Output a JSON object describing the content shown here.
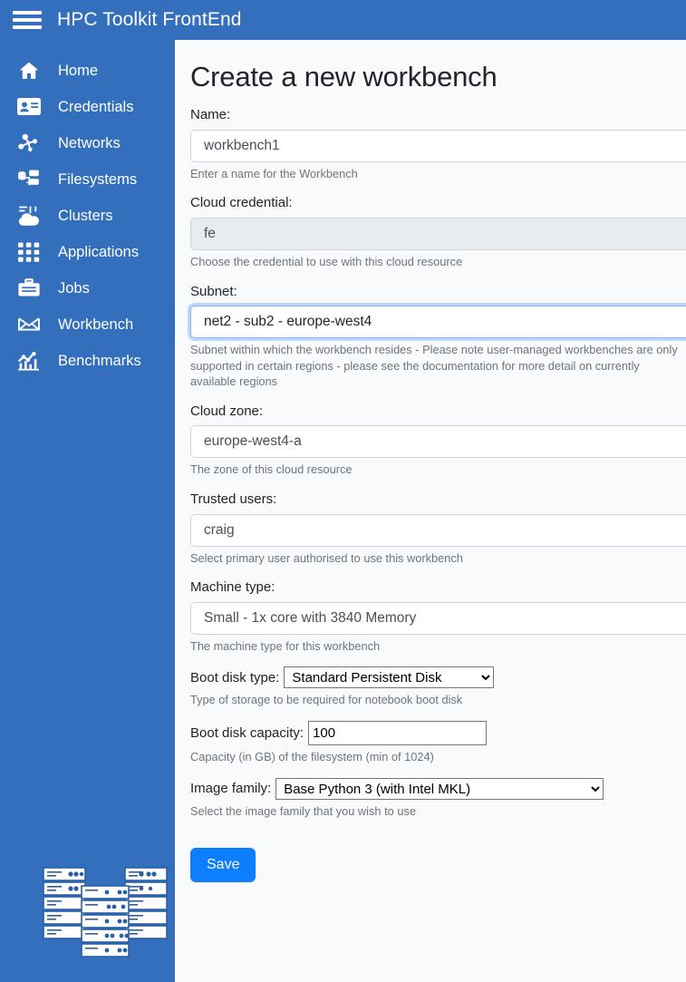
{
  "header": {
    "brand": "HPC Toolkit FrontEnd",
    "menu_icon": "hamburger-icon"
  },
  "theme": {
    "brand_blue": "#336fbc",
    "accent_blue": "#0d7efd",
    "page_bg": "#f9fafb",
    "text": "#212529",
    "muted_text": "#6c757d",
    "border": "#ced4da"
  },
  "sidebar": {
    "items": [
      {
        "label": "Home",
        "icon": "home-icon"
      },
      {
        "label": "Credentials",
        "icon": "id-card-icon"
      },
      {
        "label": "Networks",
        "icon": "network-nodes-icon"
      },
      {
        "label": "Filesystems",
        "icon": "filesystems-icon"
      },
      {
        "label": "Clusters",
        "icon": "clusters-icon"
      },
      {
        "label": "Applications",
        "icon": "applications-grid-icon"
      },
      {
        "label": "Jobs",
        "icon": "briefcase-icon"
      },
      {
        "label": "Workbench",
        "icon": "workbench-icon"
      },
      {
        "label": "Benchmarks",
        "icon": "benchmarks-chart-icon"
      }
    ],
    "logo": "server-rack-illustration"
  },
  "main": {
    "title": "Create a new workbench",
    "fields": {
      "name": {
        "label": "Name:",
        "value": "workbench1",
        "help": "Enter a name for the Workbench"
      },
      "cloud_credential": {
        "label": "Cloud credential:",
        "value": "fe",
        "help": "Choose the credential to use with this cloud resource"
      },
      "subnet": {
        "label": "Subnet:",
        "value": "net2 - sub2 - europe-west4",
        "help": "Subnet within which the workbench resides - Please note user-managed workbenches are only supported in certain regions - please see the documentation for more detail on currently available regions"
      },
      "cloud_zone": {
        "label": "Cloud zone:",
        "value": "europe-west4-a",
        "help": "The zone of this cloud resource"
      },
      "trusted_users": {
        "label": "Trusted users:",
        "value": "craig",
        "help": "Select primary user authorised to use this workbench"
      },
      "machine_type": {
        "label": "Machine type:",
        "value": "Small - 1x core with 3840 Memory",
        "help": "The machine type for this workbench"
      },
      "boot_disk_type": {
        "label": "Boot disk type:",
        "value": "Standard Persistent Disk",
        "options": [
          "Standard Persistent Disk"
        ],
        "help": "Type of storage to be required for notebook boot disk"
      },
      "boot_disk_capacity": {
        "label": "Boot disk capacity:",
        "value": "100",
        "help": "Capacity (in GB) of the filesystem (min of 1024)"
      },
      "image_family": {
        "label": "Image family:",
        "value": "Base Python 3 (with Intel MKL)",
        "options": [
          "Base Python 3 (with Intel MKL)"
        ],
        "help": "Select the image family that you wish to use"
      }
    },
    "save_label": "Save"
  }
}
